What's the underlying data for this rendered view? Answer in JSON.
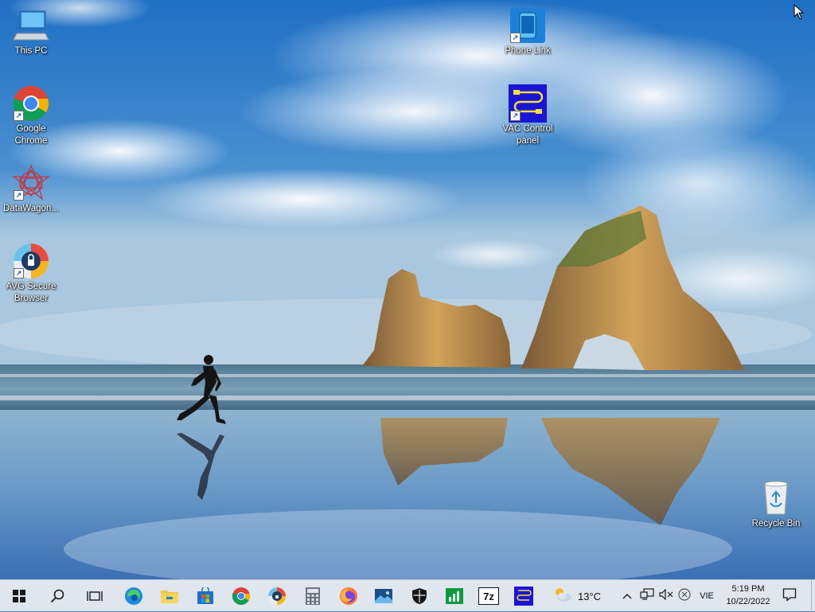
{
  "desktop": {
    "icons": [
      {
        "label": "This PC"
      },
      {
        "label": "Google Chrome"
      },
      {
        "label": "DataWagon..."
      },
      {
        "label": "AVG Secure Browser"
      },
      {
        "label": "Phone Link"
      },
      {
        "label": "VAC Control panel"
      },
      {
        "label": "Recycle Bin"
      }
    ]
  },
  "taskbar": {
    "pinned": [
      {
        "icon": "start-windows-icon"
      },
      {
        "icon": "search-icon"
      },
      {
        "icon": "task-view-icon"
      },
      {
        "icon": "edge-icon"
      },
      {
        "icon": "file-explorer-icon"
      },
      {
        "icon": "microsoft-store-icon"
      },
      {
        "icon": "chrome-icon"
      },
      {
        "icon": "avg-secure-browser-icon"
      },
      {
        "icon": "calculator-icon"
      },
      {
        "icon": "firefox-icon"
      },
      {
        "icon": "photos-icon"
      },
      {
        "icon": "security-shield-icon"
      },
      {
        "icon": "task-manager-icon"
      },
      {
        "icon": "7zip-icon"
      },
      {
        "icon": "vac-control-icon"
      }
    ],
    "weather": {
      "temp": "13°C",
      "icon": "partly-cloudy-icon"
    },
    "tray": {
      "language": "VIE",
      "time": "5:19 PM",
      "date": "10/22/2022"
    }
  }
}
